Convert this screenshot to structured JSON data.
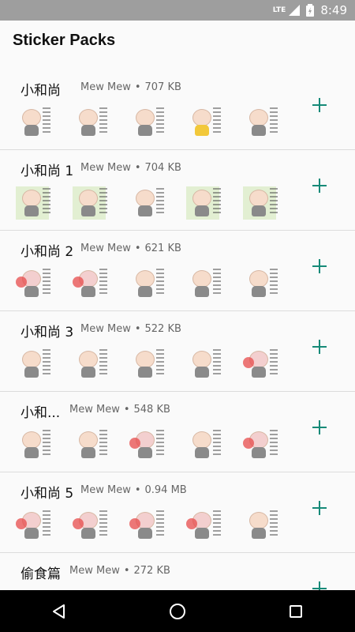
{
  "status_bar": {
    "network": "LTE",
    "time": "8:49"
  },
  "app_bar": {
    "title": "Sticker Packs"
  },
  "packs": [
    {
      "name": "小和尚",
      "author": "Mew Mew",
      "size": "707 KB"
    },
    {
      "name": "小和尚 1",
      "author": "Mew Mew",
      "size": "704 KB"
    },
    {
      "name": "小和尚 2",
      "author": "Mew Mew",
      "size": "621 KB"
    },
    {
      "name": "小和尚 3",
      "author": "Mew Mew",
      "size": "522 KB"
    },
    {
      "name": "小和...",
      "author": "Mew Mew",
      "size": "548 KB"
    },
    {
      "name": "小和尚 5",
      "author": "Mew Mew",
      "size": "0.94 MB"
    },
    {
      "name": "偷食篇",
      "author": "Mew Mew",
      "size": "272 KB"
    }
  ],
  "separator": "•",
  "icons": {
    "add": "plus-icon",
    "back": "back-triangle-icon",
    "home": "home-circle-icon",
    "recents": "recents-square-icon"
  },
  "colors": {
    "accent": "#168a78",
    "status_bar": "#9e9e9e",
    "nav_bar": "#000000"
  }
}
